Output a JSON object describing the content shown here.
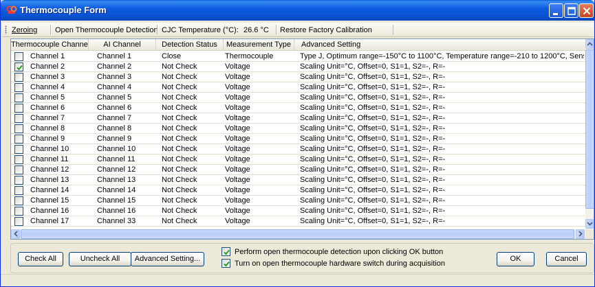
{
  "window": {
    "title": "Thermocouple Form",
    "accent": "#0b55d6"
  },
  "toolbar": {
    "zeroing": "Zeroing",
    "open_detection": "Open Thermocouple Detection",
    "cjc_label": "CJC Temperature (°C):",
    "cjc_value": "26.6 °C",
    "restore": "Restore Factory Calibration"
  },
  "table": {
    "columns": [
      "Thermocouple Channel",
      "AI Channel",
      "Detection Status",
      "Measurement Type",
      "Advanced Setting"
    ],
    "rows": [
      {
        "checked": false,
        "tc": "Channel 1",
        "ai": "Channel 1",
        "status": "Close",
        "type": "Thermocouple",
        "adv": "Type J, Optimum range=-150°C to 1100°C, Temperature range=-210 to 1200°C, Sensor info= (+)Iron"
      },
      {
        "checked": true,
        "tc": "Channel 2",
        "ai": "Channel 2",
        "status": "Not Check",
        "type": "Voltage",
        "adv": "Scaling Unit=°C, Offset=0, S1=1, S2=-, R=-"
      },
      {
        "checked": false,
        "tc": "Channel 3",
        "ai": "Channel 3",
        "status": "Not Check",
        "type": "Voltage",
        "adv": "Scaling Unit=°C, Offset=0, S1=1, S2=-, R=-"
      },
      {
        "checked": false,
        "tc": "Channel 4",
        "ai": "Channel 4",
        "status": "Not Check",
        "type": "Voltage",
        "adv": "Scaling Unit=°C, Offset=0, S1=1, S2=-, R=-"
      },
      {
        "checked": false,
        "tc": "Channel 5",
        "ai": "Channel 5",
        "status": "Not Check",
        "type": "Voltage",
        "adv": "Scaling Unit=°C, Offset=0, S1=1, S2=-, R=-"
      },
      {
        "checked": false,
        "tc": "Channel 6",
        "ai": "Channel 6",
        "status": "Not Check",
        "type": "Voltage",
        "adv": "Scaling Unit=°C, Offset=0, S1=1, S2=-, R=-"
      },
      {
        "checked": false,
        "tc": "Channel 7",
        "ai": "Channel 7",
        "status": "Not Check",
        "type": "Voltage",
        "adv": "Scaling Unit=°C, Offset=0, S1=1, S2=-, R=-"
      },
      {
        "checked": false,
        "tc": "Channel 8",
        "ai": "Channel 8",
        "status": "Not Check",
        "type": "Voltage",
        "adv": "Scaling Unit=°C, Offset=0, S1=1, S2=-, R=-"
      },
      {
        "checked": false,
        "tc": "Channel 9",
        "ai": "Channel 9",
        "status": "Not Check",
        "type": "Voltage",
        "adv": "Scaling Unit=°C, Offset=0, S1=1, S2=-, R=-"
      },
      {
        "checked": false,
        "tc": "Channel 10",
        "ai": "Channel 10",
        "status": "Not Check",
        "type": "Voltage",
        "adv": "Scaling Unit=°C, Offset=0, S1=1, S2=-, R=-"
      },
      {
        "checked": false,
        "tc": "Channel 11",
        "ai": "Channel 11",
        "status": "Not Check",
        "type": "Voltage",
        "adv": "Scaling Unit=°C, Offset=0, S1=1, S2=-, R=-"
      },
      {
        "checked": false,
        "tc": "Channel 12",
        "ai": "Channel 12",
        "status": "Not Check",
        "type": "Voltage",
        "adv": "Scaling Unit=°C, Offset=0, S1=1, S2=-, R=-"
      },
      {
        "checked": false,
        "tc": "Channel 13",
        "ai": "Channel 13",
        "status": "Not Check",
        "type": "Voltage",
        "adv": "Scaling Unit=°C, Offset=0, S1=1, S2=-, R=-"
      },
      {
        "checked": false,
        "tc": "Channel 14",
        "ai": "Channel 14",
        "status": "Not Check",
        "type": "Voltage",
        "adv": "Scaling Unit=°C, Offset=0, S1=1, S2=-, R=-"
      },
      {
        "checked": false,
        "tc": "Channel 15",
        "ai": "Channel 15",
        "status": "Not Check",
        "type": "Voltage",
        "adv": "Scaling Unit=°C, Offset=0, S1=1, S2=-, R=-"
      },
      {
        "checked": false,
        "tc": "Channel 16",
        "ai": "Channel 16",
        "status": "Not Check",
        "type": "Voltage",
        "adv": "Scaling Unit=°C, Offset=0, S1=1, S2=-, R=-"
      },
      {
        "checked": false,
        "tc": "Channel 17",
        "ai": "Channel 33",
        "status": "Not Check",
        "type": "Voltage",
        "adv": "Scaling Unit=°C, Offset=0, S1=1, S2=-, R=-"
      }
    ]
  },
  "buttons": {
    "check_all": "Check All",
    "uncheck_all": "Uncheck All",
    "advanced_setting": "Advanced Setting...",
    "ok": "OK",
    "cancel": "Cancel"
  },
  "options": {
    "opt1": "Perform open thermocouple detection upon clicking OK button",
    "opt2": "Turn on open thermocouple hardware switch during acquisition"
  }
}
